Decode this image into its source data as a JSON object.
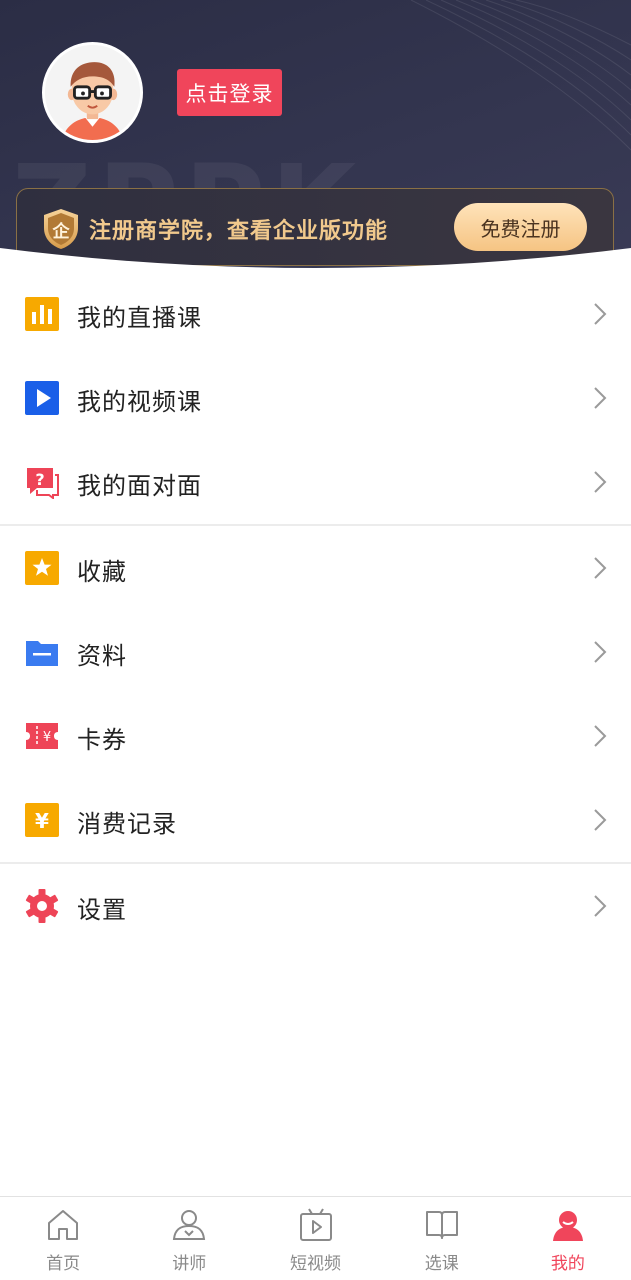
{
  "header": {
    "watermark": "ZPPK",
    "login_label": "点击登录",
    "banner": {
      "shield_char": "企",
      "text": "注册商学院，查看企业版功能",
      "register_label": "免费注册"
    }
  },
  "menu": {
    "group1": [
      {
        "label": "我的直播课",
        "icon": "live-course-icon",
        "color": "#f7a900"
      },
      {
        "label": "我的视频课",
        "icon": "video-course-icon",
        "color": "#1a5fe8"
      },
      {
        "label": "我的面对面",
        "icon": "face-to-face-icon",
        "color": "#ee4457"
      }
    ],
    "group2": [
      {
        "label": "收藏",
        "icon": "star-icon",
        "color": "#f7a900"
      },
      {
        "label": "资料",
        "icon": "folder-icon",
        "color": "#3a7bf0"
      },
      {
        "label": "卡券",
        "icon": "coupon-icon",
        "color": "#ee4457"
      },
      {
        "label": "消费记录",
        "icon": "yuan-icon",
        "color": "#f7a900"
      }
    ],
    "group3": [
      {
        "label": "设置",
        "icon": "settings-gear-icon",
        "color": "#ee4457"
      }
    ]
  },
  "tabbar": {
    "tabs": [
      {
        "label": "首页",
        "icon": "home-icon",
        "active": false
      },
      {
        "label": "讲师",
        "icon": "lecturer-icon",
        "active": false
      },
      {
        "label": "短视频",
        "icon": "short-video-icon",
        "active": false
      },
      {
        "label": "选课",
        "icon": "course-select-icon",
        "active": false
      },
      {
        "label": "我的",
        "icon": "profile-icon",
        "active": true
      }
    ],
    "active_color": "#f0455b",
    "inactive_color": "#8a8a8a"
  }
}
